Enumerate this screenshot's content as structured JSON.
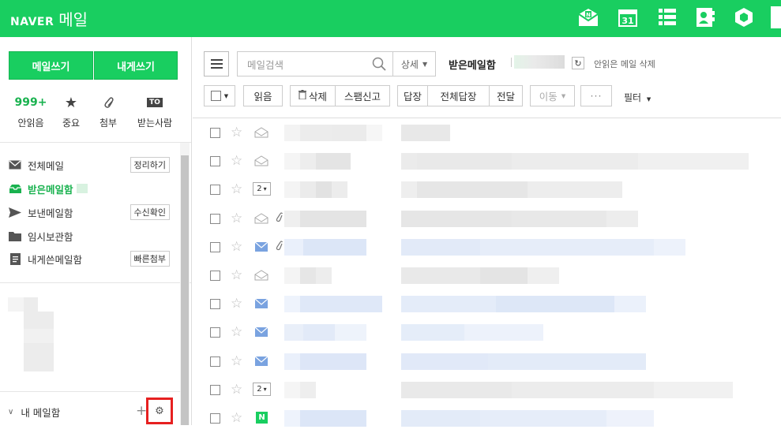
{
  "header": {
    "brand": "NAVER",
    "app_title": "메일",
    "calendar_day": "31"
  },
  "sidebar": {
    "write_mail": "메일쓰기",
    "write_to_me": "내게쓰기",
    "quick": [
      {
        "value": "999+",
        "label": "안읽음"
      },
      {
        "value": "",
        "label": "중요"
      },
      {
        "value": "",
        "label": "첨부"
      },
      {
        "value": "TO",
        "label": "받는사람"
      }
    ],
    "folders": [
      {
        "label": "전체메일",
        "action": "정리하기"
      },
      {
        "label": "받은메일함",
        "action": ""
      },
      {
        "label": "보낸메일함",
        "action": "수신확인"
      },
      {
        "label": "임시보관함",
        "action": ""
      },
      {
        "label": "내게쓴메일함",
        "action": "빠른첨부"
      }
    ],
    "my_mailbox": "내 메일함",
    "plus": "+"
  },
  "main": {
    "search_placeholder": "메일검색",
    "detail": "상세",
    "inbox_title": "받은메일함",
    "refresh": "↻",
    "delete_unread": "안읽은 메일 삭제",
    "toolbar": {
      "read": "읽음",
      "delete": "삭제",
      "spam": "스팸신고",
      "reply": "답장",
      "reply_all": "전체답장",
      "forward": "전달",
      "move": "이동",
      "more": "···",
      "filter": "필터"
    },
    "rows": [
      {
        "status": "envelope-open",
        "count": "",
        "attach": false
      },
      {
        "status": "envelope-open",
        "count": "",
        "attach": false
      },
      {
        "status": "count",
        "count": "2",
        "attach": false
      },
      {
        "status": "envelope-open",
        "count": "",
        "attach": true
      },
      {
        "status": "envelope-unread",
        "count": "",
        "attach": true
      },
      {
        "status": "envelope-open",
        "count": "",
        "attach": false
      },
      {
        "status": "envelope-unread",
        "count": "",
        "attach": false
      },
      {
        "status": "envelope-unread",
        "count": "",
        "attach": false
      },
      {
        "status": "envelope-unread",
        "count": "",
        "attach": false
      },
      {
        "status": "count",
        "count": "2",
        "attach": false
      },
      {
        "status": "naver-badge",
        "count": "N",
        "attach": false
      }
    ]
  },
  "colors": {
    "brand_green": "#19ce60",
    "highlight_red": "#e62020",
    "unread_blue": "#7aa3e0"
  }
}
